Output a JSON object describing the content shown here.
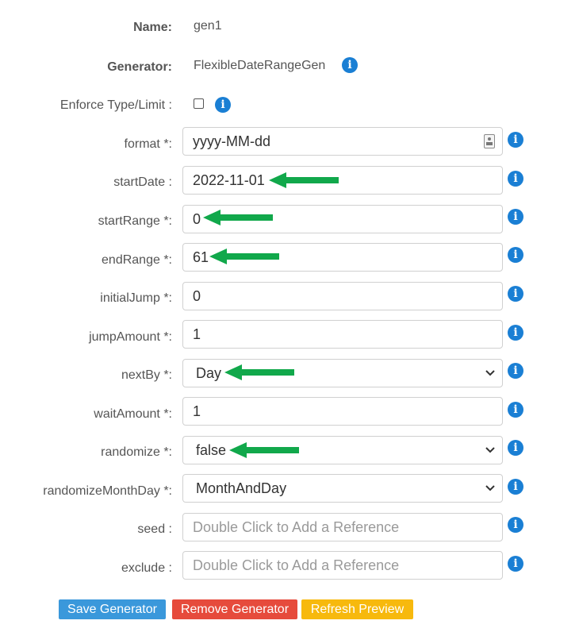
{
  "header": {
    "name_label": "Name:",
    "name_value": "gen1",
    "generator_label": "Generator:",
    "generator_value": "FlexibleDateRangeGen",
    "enforce_label": "Enforce Type/Limit :"
  },
  "fields": {
    "format": {
      "label": "format *:",
      "value": "yyyy-MM-dd"
    },
    "startDate": {
      "label": "startDate :",
      "value": "2022-11-01"
    },
    "startRange": {
      "label": "startRange *:",
      "value": "0"
    },
    "endRange": {
      "label": "endRange *:",
      "value": "61"
    },
    "initialJump": {
      "label": "initialJump *:",
      "value": "0"
    },
    "jumpAmount": {
      "label": "jumpAmount *:",
      "value": "1"
    },
    "nextBy": {
      "label": "nextBy *:",
      "value": "Day"
    },
    "waitAmount": {
      "label": "waitAmount *:",
      "value": "1"
    },
    "randomize": {
      "label": "randomize *:",
      "value": "false"
    },
    "randomizeMonthDay": {
      "label": "randomizeMonthDay *:",
      "value": "MonthAndDay"
    },
    "seed": {
      "label": "seed :",
      "placeholder": "Double Click to Add a Reference"
    },
    "exclude": {
      "label": "exclude :",
      "placeholder": "Double Click to Add a Reference"
    }
  },
  "icons": {
    "info": "i",
    "chevron": "⌄"
  },
  "buttons": {
    "save": "Save Generator",
    "remove": "Remove Generator",
    "refresh": "Refresh Preview"
  },
  "colors": {
    "info_blue": "#1a7fd4",
    "arrow_green": "#11a84b",
    "save_bg": "#3a98db",
    "remove_bg": "#e64b3c",
    "refresh_bg": "#f7b90d"
  }
}
